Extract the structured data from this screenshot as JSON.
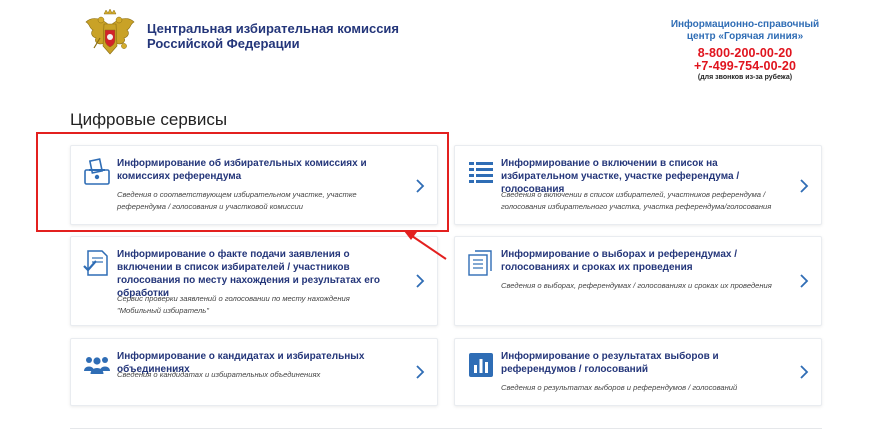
{
  "header": {
    "org_title_line1": "Центральная избирательная комиссия",
    "org_title_line2": "Российской Федерации",
    "emblem_icon": "coat-of-arms-icon",
    "hotline": {
      "title_line1": "Информационно-справочный",
      "title_line2": "центр «Горячая линия»",
      "phone1": "8-800-200-00-20",
      "phone2": "+7-499-754-00-20",
      "note": "(для звонков из-за рубежа)"
    }
  },
  "main": {
    "section_title": "Цифровые сервисы",
    "cards": [
      {
        "title": "Информирование об избирательных комиссиях и комиссиях референдума",
        "description": "Сведения о соответствующем избирательном участке, участке референдума / голосования и участковой комиссии",
        "icon": "ballot-box-icon"
      },
      {
        "title": "Информирование о включении в список на избирательном участке, участке референдума / голосования",
        "description": "Сведения о включении в список избирателей, участников референдума / голосования избирательного участка, участка референдума/голосования",
        "icon": "list-icon"
      },
      {
        "title": "Информирование о факте подачи заявления о включении в список избирателей / участников голосования по месту нахождения и результатах его обработки",
        "description_line1": "Сервис проверки заявлений о голосовании по месту нахождения",
        "description_line2": "\"Мобильный избиратель\"",
        "icon": "document-check-icon"
      },
      {
        "title": "Информирование о выборах и референдумах / голосованиях и сроках их проведения",
        "description": "Сведения о выборах, референдумах / голосованиях и сроках их проведения",
        "icon": "documents-icon"
      },
      {
        "title": "Информирование о кандидатах и избирательных объединениях",
        "description": "Сведения о кандидатах и избирательных объединениях",
        "icon": "people-icon"
      },
      {
        "title": "Информирование о результатах выборов и референдумов / голосований",
        "description": "Сведения о результатах выборов и референдумов / голосований",
        "icon": "bar-chart-icon"
      }
    ]
  },
  "colors": {
    "title_blue": "#24367a",
    "icon_blue": "#2f6db5",
    "hotline_red": "#e0141e",
    "annotation_red": "#e3201f"
  }
}
